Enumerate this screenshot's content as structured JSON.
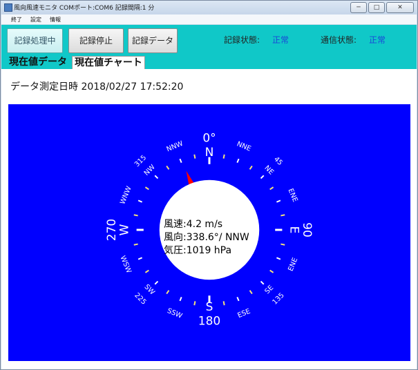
{
  "window": {
    "title": "風向風速モニタ COMポート:COM6 記録間隔:1 分",
    "minimize_symbol": "─",
    "maximize_symbol": "□",
    "close_symbol": "✕"
  },
  "menu": [
    "終了",
    "設定",
    "情報"
  ],
  "toolbar": {
    "record_processing": "記録処理中",
    "record_stop": "記録停止",
    "record_data": "記録データ",
    "record_status_label": "記録状態:",
    "record_status_value": "正常",
    "comm_status_label": "通信状態:",
    "comm_status_value": "正常"
  },
  "tabs": {
    "current_data": "現在値データ",
    "current_chart": "現在値チャート"
  },
  "datetime_label": "データ測定日時 2018/02/27 17:52:20",
  "compass": {
    "direction_labels": [
      {
        "text": "0°",
        "deg": 0,
        "r": 0.78
      },
      {
        "text": "N",
        "deg": 0,
        "r": 0.66
      },
      {
        "text": "NNE",
        "deg": 22.5,
        "r": 0.77
      },
      {
        "text": "45",
        "deg": 45,
        "r": 0.83
      },
      {
        "text": "NE",
        "deg": 45,
        "r": 0.72
      },
      {
        "text": "ENE",
        "deg": 67.5,
        "r": 0.77
      },
      {
        "text": "90",
        "deg": 90,
        "r": 0.83
      },
      {
        "text": "E",
        "deg": 90,
        "r": 0.72
      },
      {
        "text": "ENE",
        "deg": 112.5,
        "r": 0.77
      },
      {
        "text": "135",
        "deg": 135,
        "r": 0.83
      },
      {
        "text": "SE",
        "deg": 135,
        "r": 0.72
      },
      {
        "text": "ESE",
        "deg": 157.5,
        "r": 0.77
      },
      {
        "text": "180",
        "deg": 180,
        "r": 0.78
      },
      {
        "text": "S",
        "deg": 180,
        "r": 0.66
      },
      {
        "text": "SSW",
        "deg": 202.5,
        "r": 0.77
      },
      {
        "text": "225",
        "deg": 225,
        "r": 0.83
      },
      {
        "text": "SW",
        "deg": 225,
        "r": 0.72
      },
      {
        "text": "WSW",
        "deg": 247.5,
        "r": 0.77
      },
      {
        "text": "270",
        "deg": 270,
        "r": 0.83
      },
      {
        "text": "W",
        "deg": 270,
        "r": 0.72
      },
      {
        "text": "WNW",
        "deg": 292.5,
        "r": 0.77
      },
      {
        "text": "315",
        "deg": 315,
        "r": 0.83
      },
      {
        "text": "NW",
        "deg": 315,
        "r": 0.72
      },
      {
        "text": "NNW",
        "deg": 337.5,
        "r": 0.77
      }
    ],
    "wind_direction_deg": 338.6,
    "pointer_color": "#ff0000",
    "dial_color": "#0000ff",
    "center_color": "#ffffff"
  },
  "readout": {
    "wind_speed": "風速:4.2 m/s",
    "wind_direction": "風向:338.6°/ NNW",
    "pressure": "気圧:1019 hPa"
  }
}
